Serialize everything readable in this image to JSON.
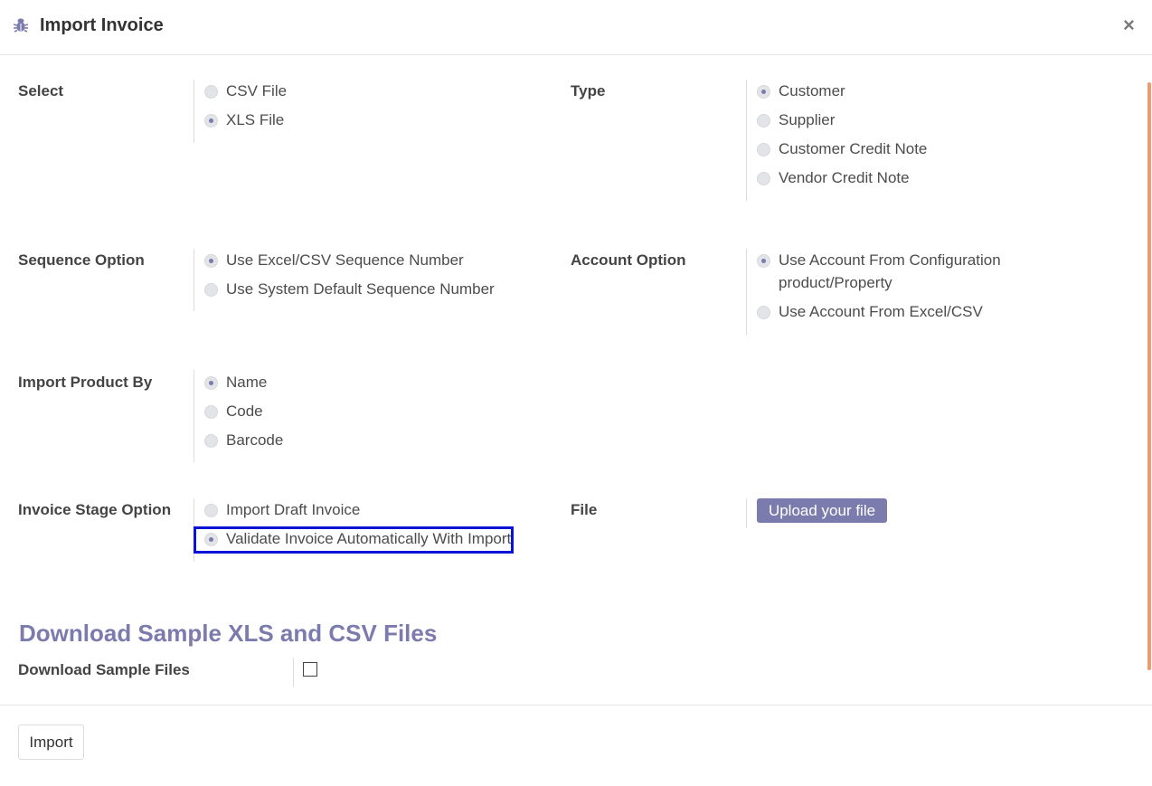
{
  "dialog": {
    "title": "Import Invoice",
    "close_symbol": "×",
    "icons": {
      "title_icon": "bug-icon",
      "close_icon": "close-icon"
    }
  },
  "select": {
    "label": "Select",
    "options": [
      {
        "label": "CSV File",
        "selected": false
      },
      {
        "label": "XLS File",
        "selected": true
      }
    ]
  },
  "type": {
    "label": "Type",
    "options": [
      {
        "label": "Customer",
        "selected": true
      },
      {
        "label": "Supplier",
        "selected": false
      },
      {
        "label": "Customer Credit Note",
        "selected": false
      },
      {
        "label": "Vendor Credit Note",
        "selected": false
      }
    ]
  },
  "sequence": {
    "label": "Sequence Option",
    "options": [
      {
        "label": "Use Excel/CSV Sequence Number",
        "selected": true
      },
      {
        "label": "Use System Default Sequence Number",
        "selected": false
      }
    ]
  },
  "account": {
    "label": "Account Option",
    "options": [
      {
        "label": "Use Account From Configuration product/Property",
        "selected": true
      },
      {
        "label": "Use Account From Excel/CSV",
        "selected": false
      }
    ]
  },
  "product": {
    "label": "Import Product By",
    "options": [
      {
        "label": "Name",
        "selected": true
      },
      {
        "label": "Code",
        "selected": false
      },
      {
        "label": "Barcode",
        "selected": false
      }
    ]
  },
  "stage": {
    "label": "Invoice Stage Option",
    "options": [
      {
        "label": "Import Draft Invoice",
        "selected": false
      },
      {
        "label": "Validate Invoice Automatically With Import",
        "selected": true
      }
    ]
  },
  "file": {
    "label": "File",
    "upload_label": "Upload your file"
  },
  "samples": {
    "section_title": "Download Sample XLS and CSV Files",
    "label": "Download Sample Files",
    "checked": false
  },
  "footer": {
    "import_label": "Import"
  },
  "colors": {
    "accent": "#7c7bad",
    "highlight_border": "#0a12d6",
    "scrollbar": "#f19a6f"
  }
}
